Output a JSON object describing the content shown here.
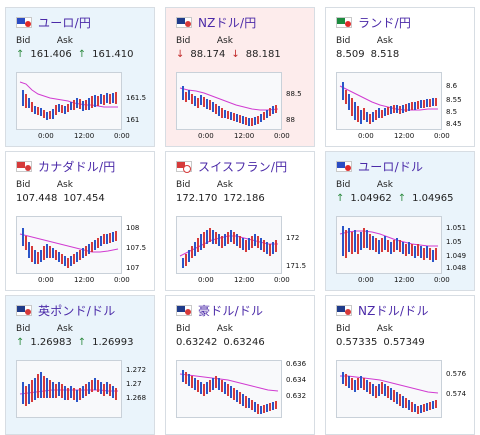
{
  "cards": [
    {
      "pair": "ユーロ/円",
      "card_state": "up",
      "bid_label": "Bid",
      "ask_label": "Ask",
      "bid": "161.406",
      "ask": "161.410",
      "arrow": "up",
      "y_ticks": [
        "161.5",
        "161"
      ],
      "x_ticks": [
        "0:00",
        "12:00",
        "0:00"
      ]
    },
    {
      "pair": "NZドル/円",
      "card_state": "down",
      "bid_label": "Bid",
      "ask_label": "Ask",
      "bid": "88.174",
      "ask": "88.181",
      "arrow": "down",
      "y_ticks": [
        "88.5",
        "88"
      ],
      "x_ticks": [
        "0:00",
        "12:00",
        "0:00"
      ]
    },
    {
      "pair": "ランド/円",
      "card_state": "neutral",
      "bid_label": "Bid",
      "ask_label": "Ask",
      "bid": "8.509",
      "ask": "8.518",
      "arrow": "",
      "y_ticks": [
        "8.6",
        "8.55",
        "8.5",
        "8.45"
      ],
      "x_ticks": [
        "0:00",
        "12:00",
        "0:00"
      ]
    },
    {
      "pair": "カナダドル/円",
      "card_state": "neutral",
      "bid_label": "Bid",
      "ask_label": "Ask",
      "bid": "107.448",
      "ask": "107.454",
      "arrow": "",
      "y_ticks": [
        "108",
        "107.5",
        "107"
      ],
      "x_ticks": [
        "0:00",
        "12:00",
        "0:00"
      ]
    },
    {
      "pair": "スイスフラン/円",
      "card_state": "neutral",
      "bid_label": "Bid",
      "ask_label": "Ask",
      "bid": "172.170",
      "ask": "172.186",
      "arrow": "",
      "y_ticks": [
        "172",
        "171.5"
      ],
      "x_ticks": [
        "0:00",
        "12:00",
        "0:00"
      ]
    },
    {
      "pair": "ユーロ/ドル",
      "card_state": "up",
      "bid_label": "Bid",
      "ask_label": "Ask",
      "bid": "1.04962",
      "ask": "1.04965",
      "arrow": "up",
      "y_ticks": [
        "1.051",
        "1.05",
        "1.049",
        "1.048"
      ],
      "x_ticks": [
        "0:00",
        "12:00",
        "0:00"
      ]
    },
    {
      "pair": "英ポンド/ドル",
      "card_state": "up",
      "bid_label": "Bid",
      "ask_label": "Ask",
      "bid": "1.26983",
      "ask": "1.26993",
      "arrow": "up",
      "y_ticks": [
        "1.272",
        "1.27",
        "1.268"
      ],
      "x_ticks": []
    },
    {
      "pair": "豪ドル/ドル",
      "card_state": "neutral",
      "bid_label": "Bid",
      "ask_label": "Ask",
      "bid": "0.63242",
      "ask": "0.63246",
      "arrow": "",
      "y_ticks": [
        "0.636",
        "0.634",
        "0.632"
      ],
      "x_ticks": []
    },
    {
      "pair": "NZドル/ドル",
      "card_state": "neutral",
      "bid_label": "Bid",
      "ask_label": "Ask",
      "bid": "0.57335",
      "ask": "0.57349",
      "arrow": "",
      "y_ticks": [
        "0.576",
        "0.574"
      ],
      "x_ticks": []
    }
  ],
  "colors": {
    "up_candle": "#2a55c8",
    "down_candle": "#d63a3a",
    "ma_line": "#d13bd1",
    "title": "#4b2aa8"
  },
  "icons": {
    "flag": "currency-flag-icon"
  }
}
